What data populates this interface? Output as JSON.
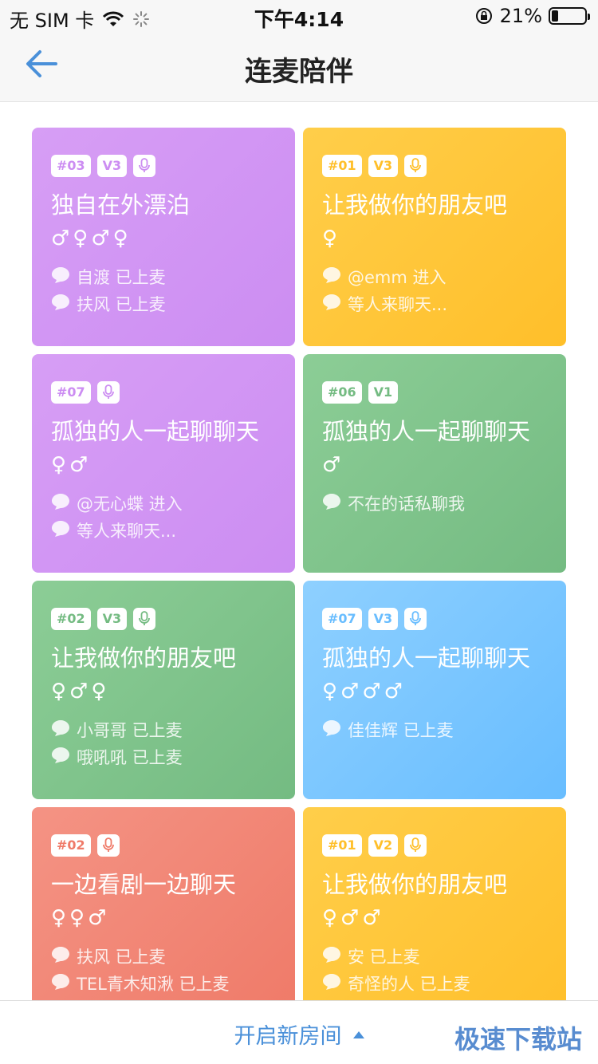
{
  "status_bar": {
    "carrier": "无 SIM 卡",
    "time": "下午4:14",
    "battery_text": "21%",
    "battery_level": 0.21
  },
  "nav": {
    "title": "连麦陪伴",
    "accent_color": "#4a90d9"
  },
  "colors": {
    "purple": "#cc8df2",
    "yellow": "#ffbf2a",
    "green": "#74bb82",
    "blue": "#68bdff",
    "red": "#ef7a68"
  },
  "rooms": [
    {
      "color": "purple",
      "tag": "#03",
      "level": "V3",
      "mic": true,
      "title": "独自在外漂泊",
      "genders": "♂♀♂♀",
      "messages": [
        "自渡 已上麦",
        "扶风 已上麦"
      ]
    },
    {
      "color": "yellow",
      "tag": "#01",
      "level": "V3",
      "mic": true,
      "title": "让我做你的朋友吧",
      "genders": "♀",
      "messages": [
        "@emm 进入",
        "等人来聊天..."
      ]
    },
    {
      "color": "purple",
      "tag": "#07",
      "level": "",
      "mic": true,
      "title": "孤独的人一起聊聊天",
      "genders": "♀♂",
      "messages": [
        "@无心蝶 进入",
        "等人来聊天..."
      ]
    },
    {
      "color": "green",
      "tag": "#06",
      "level": "V1",
      "mic": false,
      "title": "孤独的人一起聊聊天",
      "genders": "♂",
      "messages": [
        "不在的话私聊我"
      ]
    },
    {
      "color": "green",
      "tag": "#02",
      "level": "V3",
      "mic": true,
      "title": "让我做你的朋友吧",
      "genders": "♀♂♀",
      "messages": [
        "小哥哥 已上麦",
        "哦吼吼 已上麦"
      ]
    },
    {
      "color": "blue",
      "tag": "#07",
      "level": "V3",
      "mic": true,
      "title": "孤独的人一起聊聊天",
      "genders": "♀♂♂♂",
      "messages": [
        "佳佳辉 已上麦"
      ]
    },
    {
      "color": "red",
      "tag": "#02",
      "level": "",
      "mic": true,
      "title": "一边看剧一边聊天",
      "genders": "♀♀♂",
      "messages": [
        "扶风 已上麦",
        "TEL青木知湫 已上麦"
      ]
    },
    {
      "color": "yellow",
      "tag": "#01",
      "level": "V2",
      "mic": true,
      "title": "让我做你的朋友吧",
      "genders": "♀♂♂",
      "messages": [
        "安 已上麦",
        "奇怪的人 已上麦"
      ]
    }
  ],
  "bottom": {
    "open_room_label": "开启新房间",
    "watermark": "极速下载站"
  }
}
